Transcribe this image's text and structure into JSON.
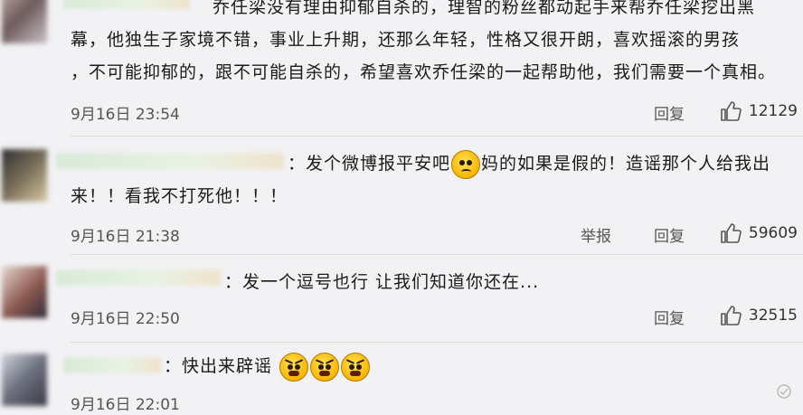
{
  "comments": [
    {
      "text_lines": [
        "乔任梁没有理由抑郁自杀的，理智的粉丝都动起手来帮乔任梁挖出黑",
        "幕，他独生子家境不错，事业上升期，还那么年轻，性格又很开朗，喜欢摇滚的男孩",
        "，不可能抑郁的，跟不可能自杀的，希望喜欢乔任梁的一起帮助他，我们需要一个真相。"
      ],
      "time": "9月16日 23:54",
      "reply": "回复",
      "likes": "12129"
    },
    {
      "text_a": "：发个微博报平安吧",
      "text_b": "妈的如果是假的！造谣那个人给我出",
      "text_c": "来！！看我不打死他！！！",
      "time": "9月16日 21:38",
      "report": "举报",
      "reply": "回复",
      "likes": "59609"
    },
    {
      "text": "：发一个逗号也行 让我们知道你还在...",
      "time": "9月16日 22:50",
      "reply": "回复",
      "likes": "32515"
    },
    {
      "text": "：快出来辟谣",
      "time": "9月16日 22:01"
    }
  ],
  "icons": {
    "like": "thumbs-up-icon",
    "emoji_sad": "sad-face-emoji",
    "emoji_angry": "angry-face-emoji"
  }
}
